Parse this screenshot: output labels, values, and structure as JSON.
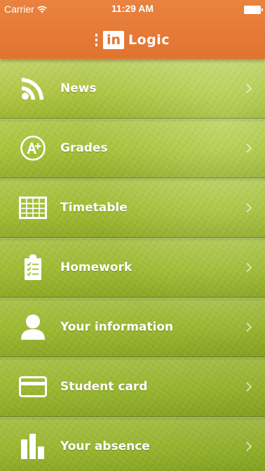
{
  "status_bar": {
    "carrier": "Carrier",
    "time": "11:29 AM"
  },
  "header": {
    "logo_box_text": "in",
    "logo_text": "Logic"
  },
  "menu": {
    "items": [
      {
        "label": "News",
        "icon": "rss-icon"
      },
      {
        "label": "Grades",
        "icon": "grade-badge-icon"
      },
      {
        "label": "Timetable",
        "icon": "table-grid-icon"
      },
      {
        "label": "Homework",
        "icon": "clipboard-checklist-icon"
      },
      {
        "label": "Your information",
        "icon": "person-icon"
      },
      {
        "label": "Student card",
        "icon": "card-icon"
      },
      {
        "label": "Your absence",
        "icon": "bar-chart-icon"
      }
    ]
  },
  "colors": {
    "header_orange": "#e27330",
    "background_green": "#9cb82a",
    "text_white": "#ffffff"
  }
}
